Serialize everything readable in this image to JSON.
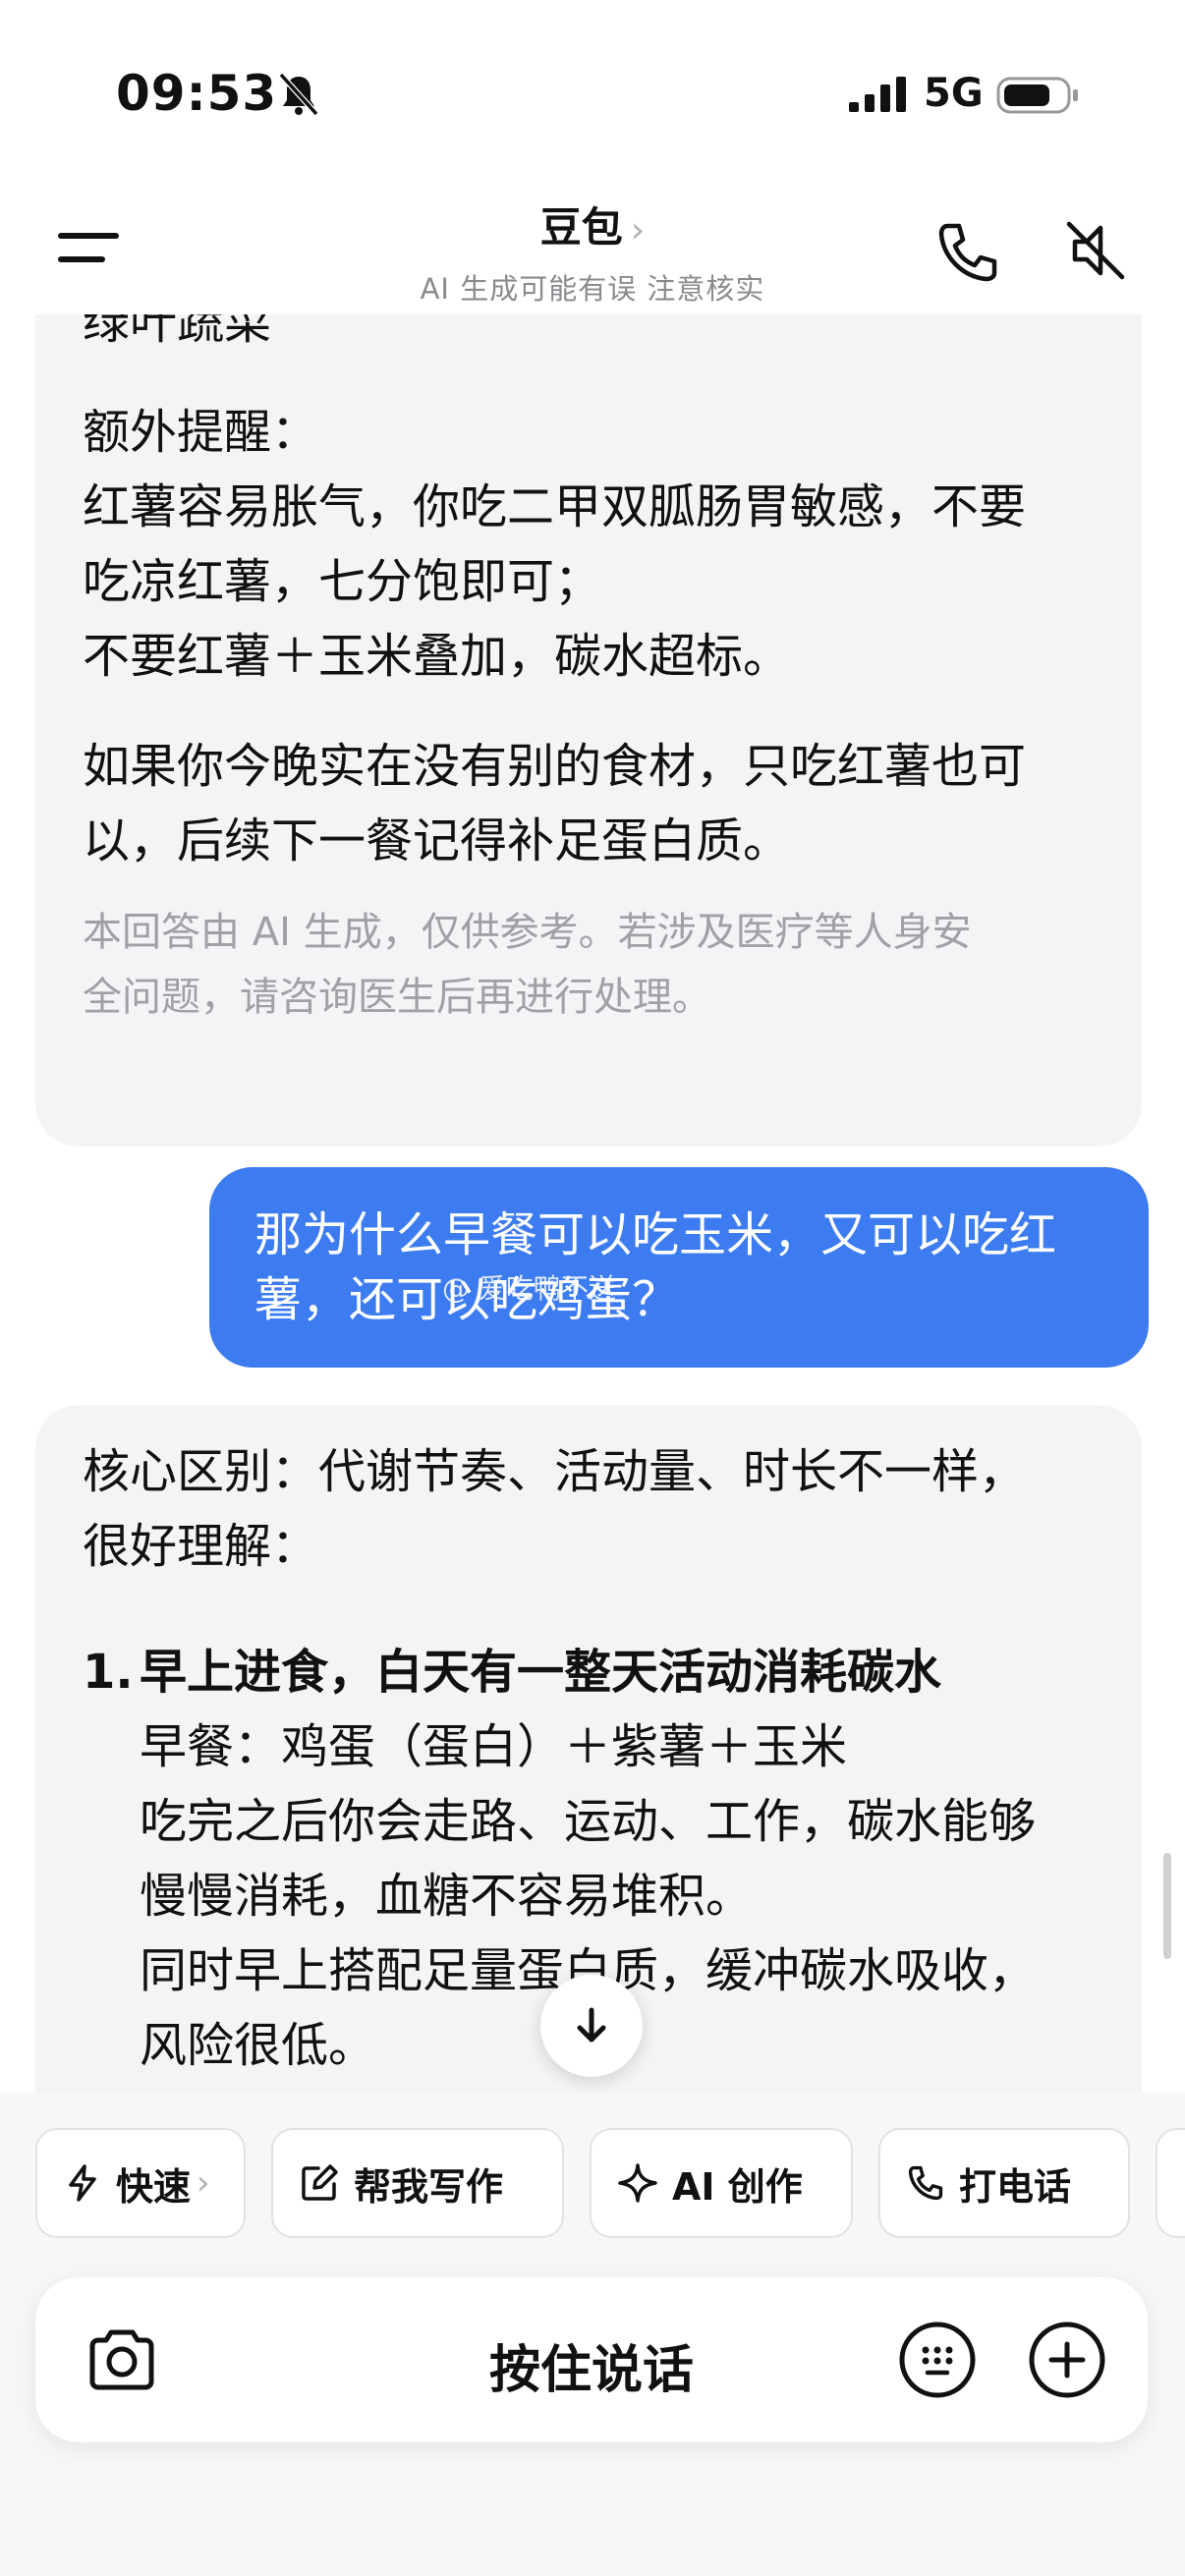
{
  "status_bar": {
    "time": "09:53",
    "network": "5G",
    "icons": [
      "bell-mute-icon",
      "signal-icon",
      "battery-icon"
    ]
  },
  "header": {
    "title": "豆包",
    "title_chevron": "›",
    "subtitle": "AI 生成可能有误 注意核实",
    "icons": [
      "menu-icon",
      "phone-icon",
      "speaker-mute-icon"
    ]
  },
  "messages": {
    "ai_1": {
      "lines": [
        "绿叶蔬菜",
        "额外提醒：",
        "红薯容易胀气，你吃二甲双胍肠胃敏感，不要",
        "吃凉红薯，七分饱即可；",
        "不要红薯＋玉米叠加，碳水超标。",
        "如果你今晚实在没有别的食材，只吃红薯也可",
        "以，后续下一餐记得补足蛋白质。"
      ],
      "disclaimer_1": "本回答由 AI 生成，仅供参考。若涉及医疗等人身安",
      "disclaimer_2": "全问题，请咨询医生后再进行处理。"
    },
    "user_1": {
      "line_1": "那为什么早餐可以吃玉米，又可以吃红",
      "line_2": "薯，还可以吃鸡蛋？",
      "watermark": "@ 爱吃鸭不送"
    },
    "ai_2": {
      "intro_1": "核心区别：代谢节奏、活动量、时长不一样，",
      "intro_2": "很好理解：",
      "item_1": {
        "number": "1.",
        "title": "早上进食，白天有一整天活动消耗碳水",
        "lines": [
          "早餐：鸡蛋（蛋白）＋紫薯＋玉米",
          "吃完之后你会走路、运动、工作，碳水能够",
          "慢慢消耗，血糖不容易堆积。",
          "同时早上搭配足量蛋白质，缓冲碳水吸收，",
          "风险很低。"
        ]
      }
    }
  },
  "toolbar": {
    "fast": "快速",
    "fast_chevron": "›",
    "write": "帮我写作",
    "create": "AI 创作",
    "call": "打电话"
  },
  "input_bar": {
    "voice_label": "按住说话",
    "icons": [
      "camera-icon",
      "keyboard-icon",
      "plus-icon"
    ]
  },
  "colors": {
    "user_bubble": "#3c7cf0",
    "ai_bubble": "#f4f4f6",
    "disclaimer": "#a0a0a6"
  }
}
